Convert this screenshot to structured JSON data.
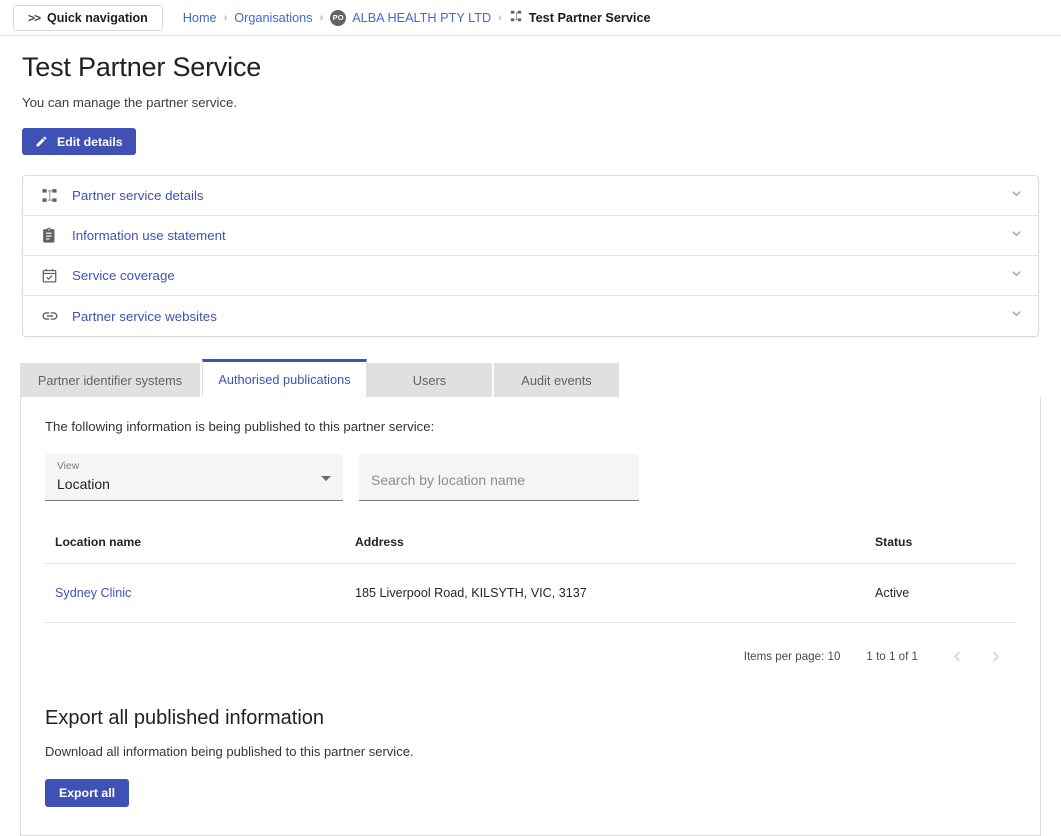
{
  "topbar": {
    "quick_nav_label": "Quick navigation",
    "quick_nav_chevrons": ">>",
    "breadcrumbs": [
      {
        "label": "Home",
        "type": "link"
      },
      {
        "label": "Organisations",
        "type": "link"
      },
      {
        "label": "ALBA HEALTH PTY LTD",
        "type": "link",
        "avatar": "PO"
      },
      {
        "label": "Test Partner Service",
        "type": "current",
        "icon": "account-tree-icon"
      }
    ],
    "separator": "›"
  },
  "header": {
    "title": "Test Partner Service",
    "subtitle": "You can manage the partner service.",
    "edit_button_label": "Edit details",
    "edit_button_icon": "pencil-icon"
  },
  "accordion": {
    "items": [
      {
        "label": "Partner service details",
        "icon": "account-tree-icon",
        "chevron": "chevron-down-icon"
      },
      {
        "label": "Information use statement",
        "icon": "document-icon",
        "chevron": "chevron-down-icon"
      },
      {
        "label": "Service coverage",
        "icon": "calendar-check-icon",
        "chevron": "chevron-down-icon"
      },
      {
        "label": "Partner service websites",
        "icon": "link-icon",
        "chevron": "chevron-down-icon"
      }
    ]
  },
  "tabs": [
    {
      "label": "Partner identifier systems",
      "active": false
    },
    {
      "label": "Authorised publications",
      "active": true
    },
    {
      "label": "Users",
      "active": false
    },
    {
      "label": "Audit events",
      "active": false
    }
  ],
  "panel": {
    "intro": "The following information is being published to this partner service:",
    "view_select": {
      "label": "View",
      "value": "Location"
    },
    "search": {
      "placeholder": "Search by location name",
      "value": ""
    },
    "table": {
      "columns": [
        "Location name",
        "Address",
        "Status"
      ],
      "rows": [
        {
          "name": "Sydney Clinic",
          "address": "185 Liverpool Road, KILSYTH, VIC, 3137",
          "status": "Active"
        }
      ]
    },
    "paginator": {
      "items_per_page_label": "Items per page:",
      "items_per_page_value": "10",
      "range_label": "1 to 1 of 1",
      "prev_icon": "chevron-left-icon",
      "next_icon": "chevron-right-icon"
    },
    "export": {
      "heading": "Export all published information",
      "description": "Download all information being published to this partner service.",
      "button_label": "Export all"
    }
  },
  "colors": {
    "primary": "#3f51b5",
    "link": "#4169cf",
    "tab_inactive_bg": "#e0e0e0",
    "field_bg": "#f5f5f5"
  }
}
